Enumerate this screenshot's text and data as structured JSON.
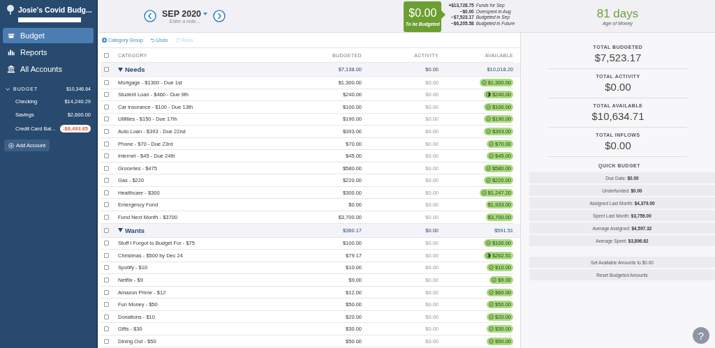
{
  "sidebar": {
    "budget_name": "Josie's Covid Budg...",
    "nav": [
      {
        "label": "Budget",
        "selected": true
      },
      {
        "label": "Reports",
        "selected": false
      },
      {
        "label": "All Accounts",
        "selected": false
      }
    ],
    "accounts_group": {
      "label": "BUDGET",
      "balance": "$10,346.64",
      "expanded": true
    },
    "accounts": [
      {
        "name": "Checking",
        "balance": "$14,240.29",
        "negative": false
      },
      {
        "name": "Savings",
        "balance": "$2,600.00",
        "negative": false
      },
      {
        "name": "Credit Card Bal...",
        "balance": "-$6,493.65",
        "negative": true
      }
    ],
    "add_account": "Add Account"
  },
  "header": {
    "month": "SEP 2020",
    "note_placeholder": "Enter a note...",
    "to_be_budgeted": {
      "amount": "$0.00",
      "label": "To be Budgeted"
    },
    "summary": [
      {
        "amount": "+$13,728.75",
        "label": "Funds for Sep"
      },
      {
        "amount": "−$0.00",
        "label": "Overspent in Aug"
      },
      {
        "amount": "−$7,523.17",
        "label": "Budgeted in Sep"
      },
      {
        "amount": "−$6,205.58",
        "label": "Budgeted in Future"
      }
    ],
    "age_of_money": {
      "value": "81 days",
      "label": "Age of Money"
    }
  },
  "toolbar": [
    {
      "label": "Category Group",
      "disabled": false
    },
    {
      "label": "Undo",
      "disabled": false
    },
    {
      "label": "Redo",
      "disabled": true
    }
  ],
  "table": {
    "all_checked": false,
    "columns": [
      "CATEGORY",
      "BUDGETED",
      "ACTIVITY",
      "AVAILABLE"
    ],
    "groups": [
      {
        "name": "Needs",
        "expanded": true,
        "checked": false,
        "budgeted": "$7,138.00",
        "activity": "$0.00",
        "available": "$10,018.20",
        "rows": [
          {
            "name": "Mortgage - $1300 - Due 1st",
            "checked": false,
            "budgeted": "$1,300.00",
            "activity": "$0.00",
            "available": "$1,300.00",
            "kind": "funded"
          },
          {
            "name": "Student Loan - $460 - Due 9th",
            "checked": false,
            "budgeted": "$240.00",
            "activity": "$0.00",
            "available": "$240.00",
            "kind": "partial"
          },
          {
            "name": "Car insurance - $100 - Due 13th",
            "checked": false,
            "budgeted": "$100.00",
            "activity": "$0.00",
            "available": "$100.00",
            "kind": "funded"
          },
          {
            "name": "Utilities - $150 - Due 17th",
            "checked": false,
            "budgeted": "$190.00",
            "activity": "$0.00",
            "available": "$190.00",
            "kind": "funded"
          },
          {
            "name": "Auto Loan - $393 - Due 22nd",
            "checked": false,
            "budgeted": "$393.00",
            "activity": "$0.00",
            "available": "$393.00",
            "kind": "funded"
          },
          {
            "name": "Phone - $70 - Due 23rd",
            "checked": false,
            "budgeted": "$70.00",
            "activity": "$0.00",
            "available": "$70.00",
            "kind": "funded"
          },
          {
            "name": "Internet - $45 - Due 24th",
            "checked": false,
            "budgeted": "$45.00",
            "activity": "$0.00",
            "available": "$45.00",
            "kind": "funded"
          },
          {
            "name": "Groceries - $475",
            "checked": false,
            "budgeted": "$580.00",
            "activity": "$0.00",
            "available": "$580.00",
            "kind": "funded"
          },
          {
            "name": "Gas - $220",
            "checked": false,
            "budgeted": "$220.00",
            "activity": "$0.00",
            "available": "$220.00",
            "kind": "funded"
          },
          {
            "name": "Healthcare - $300",
            "checked": false,
            "budgeted": "$300.00",
            "activity": "$0.00",
            "available": "$1,247.20",
            "kind": "funded"
          },
          {
            "name": "Emergency Fund",
            "checked": false,
            "budgeted": "$0.00",
            "activity": "$0.00",
            "available": "$1,933.00",
            "kind": "plain"
          },
          {
            "name": "Fund Next Month - $3700",
            "checked": false,
            "budgeted": "$3,700.00",
            "activity": "$0.00",
            "available": "$3,700.00",
            "kind": "plain"
          }
        ]
      },
      {
        "name": "Wants",
        "expanded": true,
        "checked": false,
        "budgeted": "$360.17",
        "activity": "$0.00",
        "available": "$591.51",
        "rows": [
          {
            "name": "Stuff I Forgot to Budget For - $75",
            "checked": false,
            "budgeted": "$100.00",
            "activity": "$0.00",
            "available": "$100.00",
            "kind": "funded"
          },
          {
            "name": "Christmas - $500 by Dec 24",
            "checked": false,
            "budgeted": "$79.17",
            "activity": "$0.00",
            "available": "$262.51",
            "kind": "partial"
          },
          {
            "name": "Spotify - $10",
            "checked": false,
            "budgeted": "$10.00",
            "activity": "$0.00",
            "available": "$10.00",
            "kind": "funded"
          },
          {
            "name": "Netflix - $9",
            "checked": false,
            "budgeted": "$9.00",
            "activity": "$0.00",
            "available": "$9.00",
            "kind": "funded"
          },
          {
            "name": "Amazon Prime - $12",
            "checked": false,
            "budgeted": "$12.00",
            "activity": "$0.00",
            "available": "$60.00",
            "kind": "funded"
          },
          {
            "name": "Fun Money - $50",
            "checked": false,
            "budgeted": "$50.00",
            "activity": "$0.00",
            "available": "$50.00",
            "kind": "funded"
          },
          {
            "name": "Donations - $10",
            "checked": false,
            "budgeted": "$20.00",
            "activity": "$0.00",
            "available": "$20.00",
            "kind": "funded"
          },
          {
            "name": "Gifts - $30",
            "checked": false,
            "budgeted": "$30.00",
            "activity": "$0.00",
            "available": "$30.00",
            "kind": "funded"
          },
          {
            "name": "Dining Out - $50",
            "checked": false,
            "budgeted": "$50.00",
            "activity": "$0.00",
            "available": "$50.00",
            "kind": "funded"
          }
        ]
      }
    ]
  },
  "inspector": {
    "totals": [
      {
        "label": "TOTAL BUDGETED",
        "value": "$7,523.17"
      },
      {
        "label": "TOTAL ACTIVITY",
        "value": "$0.00"
      },
      {
        "label": "TOTAL AVAILABLE",
        "value": "$10,634.71"
      },
      {
        "label": "TOTAL INFLOWS",
        "value": "$0.00"
      }
    ],
    "quick_budget_title": "QUICK BUDGET",
    "quick_budget": [
      {
        "label": "Due Date:",
        "value": "$0.00"
      },
      {
        "label": "Underfunded:",
        "value": "$0.00"
      },
      {
        "label": "Assigned Last Month:",
        "value": "$4,379.00"
      },
      {
        "label": "Spent Last Month:",
        "value": "$3,759.00"
      },
      {
        "label": "Average Assigned:",
        "value": "$4,597.32"
      },
      {
        "label": "Average Spent:",
        "value": "$3,896.62"
      }
    ],
    "actions": [
      "Set Available Amounts to $0.00",
      "Reset Budgeted Amounts"
    ],
    "help": "?"
  }
}
